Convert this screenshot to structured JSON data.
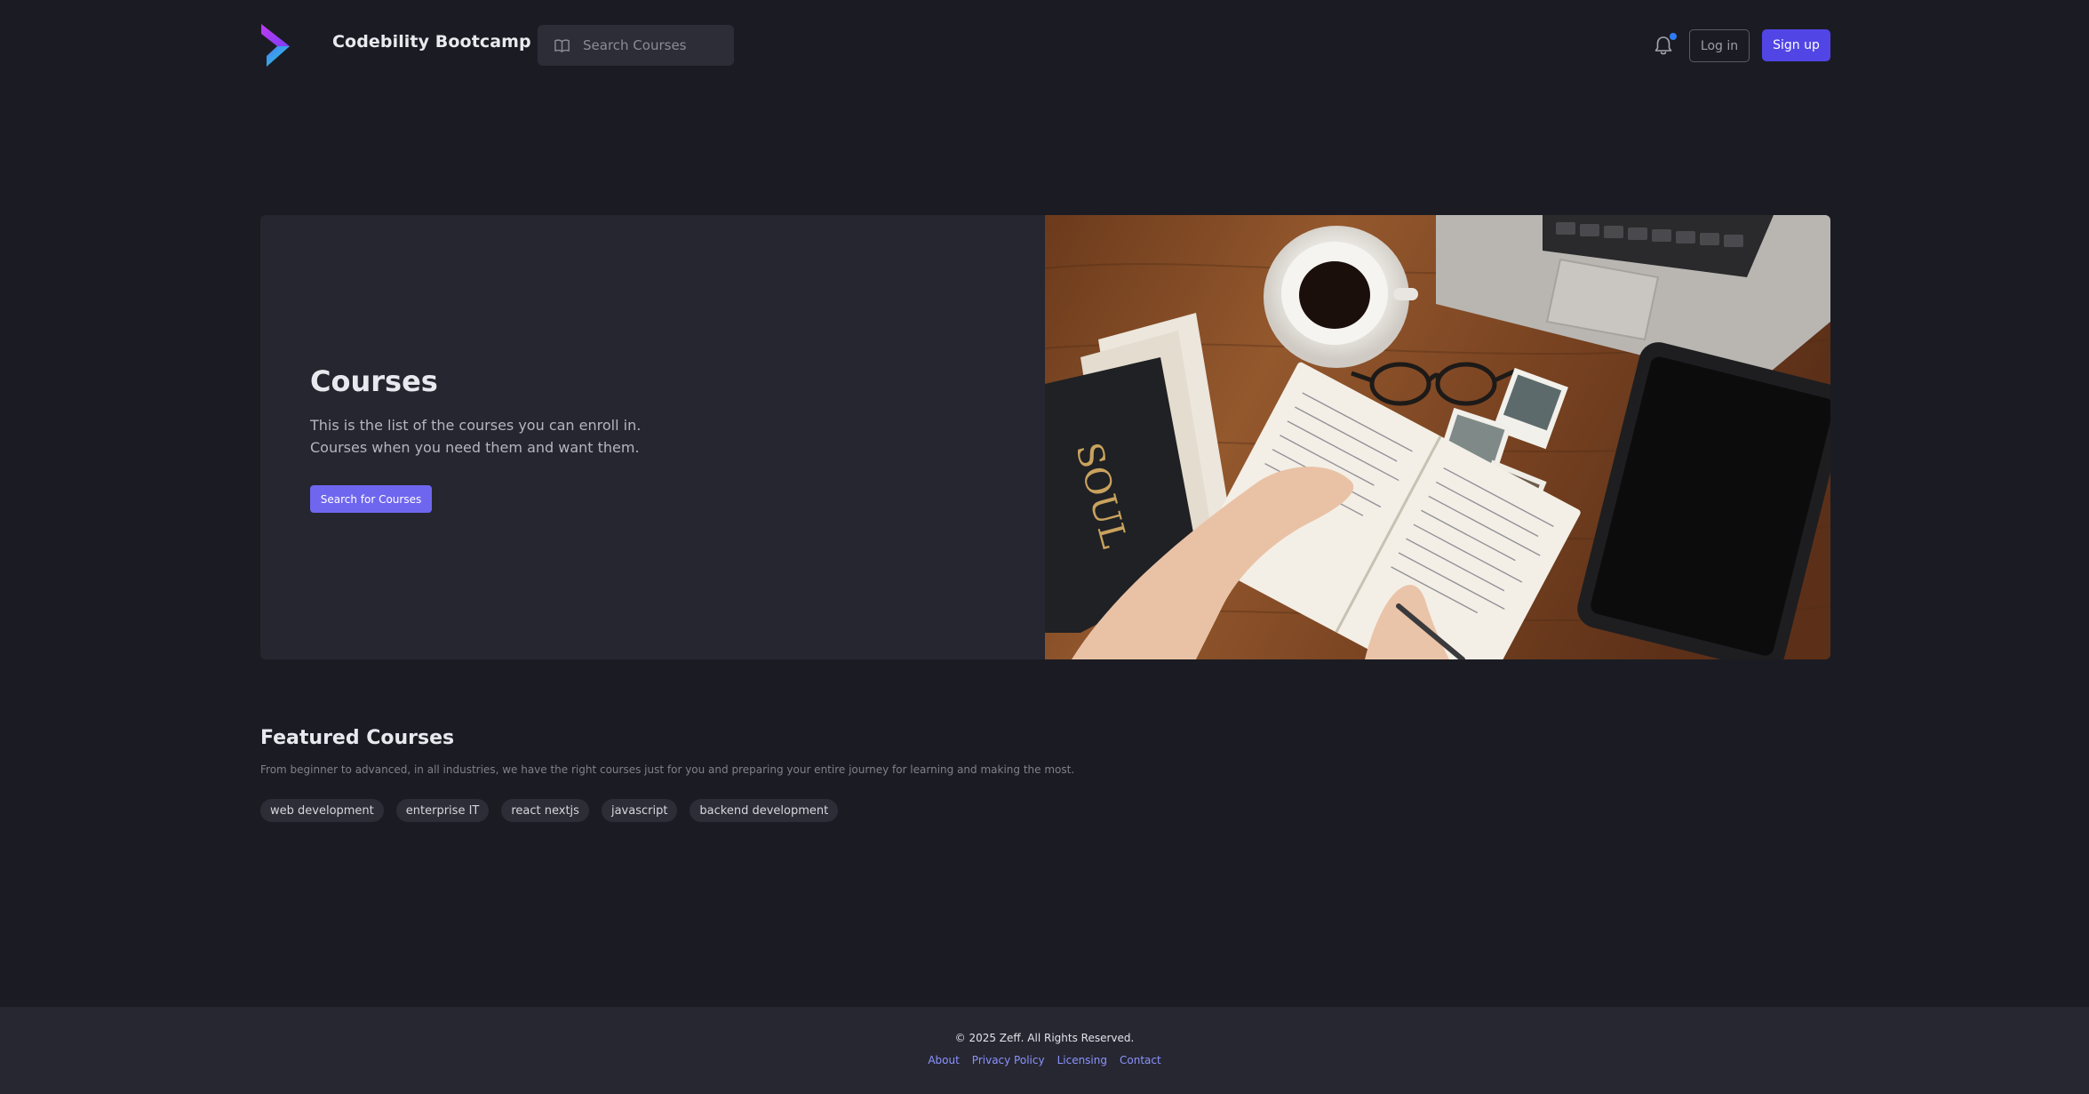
{
  "colors": {
    "background": "#1b1c23",
    "accent": "#5145e6",
    "hero_button": "#6f66ef",
    "notification_dot": "#2f7cf6",
    "footer_link": "#8c93ff"
  },
  "header": {
    "logo_icon": "chevron-logo-icon",
    "brand": "Codebility Bootcamp",
    "search": {
      "icon": "book-icon",
      "placeholder": "Search Courses"
    },
    "notification_icon": "bell-icon",
    "login_label": "Log in",
    "signup_label": "Sign up"
  },
  "hero": {
    "title": "Courses",
    "description": "This is the list of the courses you can enroll in.\nCourses when you need them and want them.",
    "button_label": "Search for Courses",
    "image": "desk-notebook-laptop-coffee-photo"
  },
  "featured": {
    "title": "Featured Courses",
    "description": "From beginner to advanced, in all industries, we have the right courses just for you and preparing your entire journey for learning and making the most.",
    "tags": [
      "web development",
      "enterprise IT",
      "react nextjs",
      "javascript",
      "backend development"
    ]
  },
  "footer": {
    "copyright": "© 2025 Zeff. All Rights Reserved.",
    "links": [
      "About",
      "Privacy Policy",
      "Licensing",
      "Contact"
    ]
  }
}
